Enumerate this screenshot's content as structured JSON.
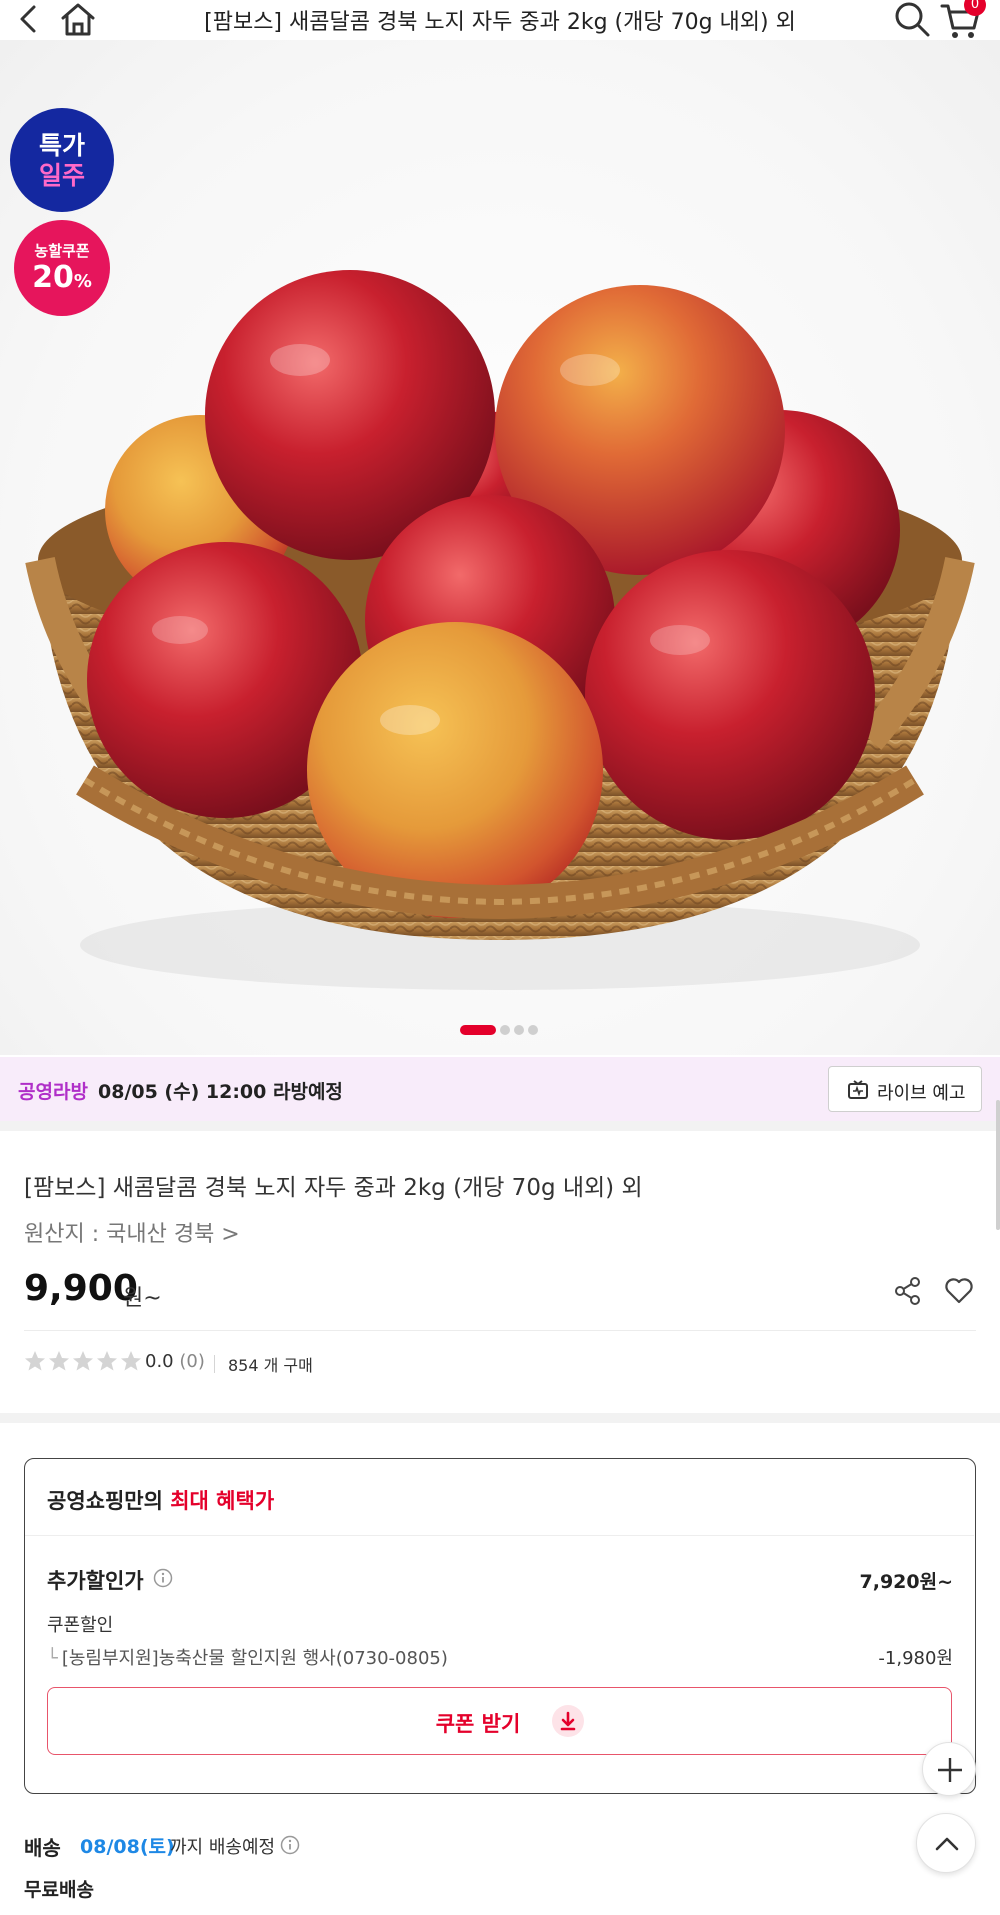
{
  "header": {
    "title": "[팜보스] 새콤달콤 경북 노지 자두 중과 2kg (개당 70g 내외) 외",
    "cart_count": "0"
  },
  "hero": {
    "badge_week_line1": "특가",
    "badge_week_line2": "일주",
    "badge_coupon_line1": "농할쿠폰",
    "badge_coupon_value": "20",
    "badge_coupon_unit": "%",
    "slide_count": 4,
    "slide_active": 1
  },
  "live": {
    "tag": "공영라방",
    "schedule": "08/05 (수) 12:00 라방예정",
    "button_label": "라이브 예고"
  },
  "product": {
    "name": "[팜보스] 새콤달콤 경북 노지 자두 중과 2kg (개당 70g 내외) 외",
    "origin": "원산지 : 국내산 경북 >",
    "price": "9,900",
    "price_unit": "원~",
    "rating": "0.0",
    "review_count": "(0)",
    "sold": "854 개 구매",
    "stars_filled": 0
  },
  "benefit": {
    "head_prefix": "공영쇼핑만의 ",
    "head_highlight": "최대 혜택가",
    "extra_label": "추가할인가",
    "extra_value": "7,920원~",
    "coupon_label": "쿠폰할인",
    "coupon_item": "[농림부지원]농축산물 할인지원 행사(0730-0805)",
    "coupon_item_prefix": "└",
    "coupon_value": "-1,980원",
    "coupon_button": "쿠폰 받기"
  },
  "delivery": {
    "label": "배송",
    "date": "08/08(토)",
    "text": "까지 배송예정",
    "fee": "무료배송"
  },
  "colors": {
    "accent": "#e4002b",
    "live_bg": "#f8ecfa",
    "live_tag": "#b02fc8",
    "delivery_date": "#1e88e5",
    "badge_week_bg": "#1428a0",
    "badge_coupon_bg": "#e6155c"
  }
}
